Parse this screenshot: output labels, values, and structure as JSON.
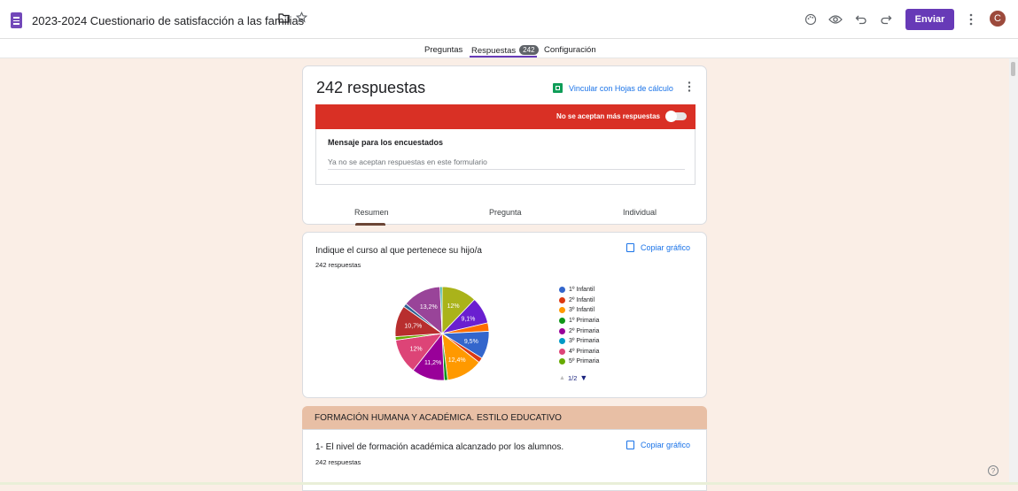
{
  "header": {
    "title": "2023-2024 Cuestionario de satisfacción a las familias",
    "send_label": "Enviar",
    "avatar_letter": "C",
    "icons": [
      "palette-icon",
      "preview-eye-icon",
      "undo-icon",
      "redo-icon",
      "more-vert-icon"
    ]
  },
  "tabs": {
    "preguntas": "Preguntas",
    "respuestas": "Respuestas",
    "respuestas_count": "242",
    "configuracion": "Configuración"
  },
  "summary": {
    "title": "242 respuestas",
    "link_sheets": "Vincular con Hojas de cálculo",
    "not_accepting": "No se aceptan más respuestas",
    "message_label": "Mensaje para los encuestados",
    "message_text": "Ya no se aceptan respuestas en este formulario",
    "tab_resumen": "Resumen",
    "tab_pregunta": "Pregunta",
    "tab_individual": "Individual"
  },
  "question1": {
    "title": "Indique el curso al que pertenece su hijo/a",
    "count": "242 respuestas",
    "copy_label": "Copiar gráfico",
    "pager_label": "1/2"
  },
  "chart_data": {
    "type": "pie",
    "title": "Indique el curso al que pertenece su hijo/a",
    "slices": [
      {
        "label": "",
        "value": 12.0,
        "color": "#aab31a"
      },
      {
        "label": "",
        "value": 9.1,
        "color": "#6a1fd0"
      },
      {
        "label": "",
        "value": 2.9,
        "color": "#ff6d00"
      },
      {
        "label": "",
        "value": 9.5,
        "color": "#3366cc"
      },
      {
        "label": "",
        "value": 1.7,
        "color": "#dc3912"
      },
      {
        "label": "",
        "value": 12.4,
        "color": "#ff9900"
      },
      {
        "label": "",
        "value": 1.2,
        "color": "#109618"
      },
      {
        "label": "",
        "value": 11.2,
        "color": "#990099"
      },
      {
        "label": "",
        "value": 12.0,
        "color": "#dd4477"
      },
      {
        "label": "",
        "value": 1.2,
        "color": "#66aa00"
      },
      {
        "label": "",
        "value": 10.7,
        "color": "#b82e2e"
      },
      {
        "label": "",
        "value": 1.2,
        "color": "#316395"
      },
      {
        "label": "",
        "value": 13.2,
        "color": "#994499"
      },
      {
        "label": "",
        "value": 0.7,
        "color": "#22aa99"
      }
    ],
    "slice_labels": [
      "12%",
      "9,1%",
      "",
      "9,5%",
      "",
      "12,4%",
      "",
      "11,2%",
      "12%",
      "",
      "10,7%",
      "",
      "13,2%",
      ""
    ],
    "legend": [
      {
        "label": "1º Infantil",
        "color": "#3366cc"
      },
      {
        "label": "2º Infantil",
        "color": "#dc3912"
      },
      {
        "label": "3º Infantil",
        "color": "#ff9900"
      },
      {
        "label": "1º Primaria",
        "color": "#109618"
      },
      {
        "label": "2º Primaria",
        "color": "#990099"
      },
      {
        "label": "3º Primaria",
        "color": "#0099c6"
      },
      {
        "label": "4º Primaria",
        "color": "#dd4477"
      },
      {
        "label": "5º Primaria",
        "color": "#66aa00"
      }
    ]
  },
  "section": {
    "title": "FORMACIÓN HUMANA Y ACADÉMICA. ESTILO EDUCATIVO"
  },
  "question2": {
    "title": "1- El nivel de formación académica alcanzado por los alumnos.",
    "count": "242 respuestas",
    "copy_label": "Copiar gráfico"
  }
}
